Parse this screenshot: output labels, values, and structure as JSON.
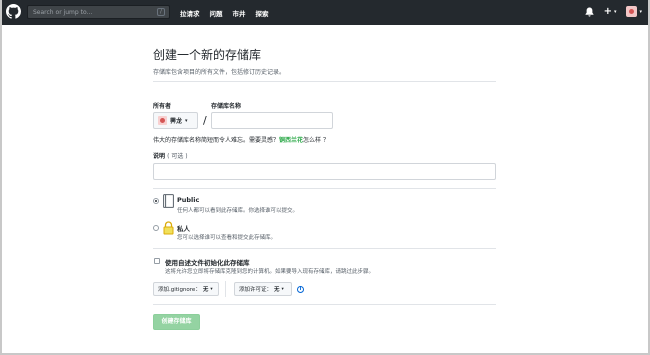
{
  "header": {
    "search_placeholder": "Search or jump to...",
    "search_shortcut": "/",
    "nav": [
      "拉请求",
      "问题",
      "市井",
      "探索"
    ],
    "plus_label": "+",
    "caret": "▾"
  },
  "page": {
    "title": "创建一个新的存储库",
    "subtitle": "存储库包含项目的所有文件，包括修订历史记录。"
  },
  "owner": {
    "label": "所有者",
    "value": "霁龙",
    "caret": "▾"
  },
  "repo_name": {
    "label": "存储库名称",
    "value": ""
  },
  "separator": "/",
  "hint": {
    "prefix": "伟大的存储库名称简短而令人难忘。需要灵感？",
    "suggestion": "铜西兰花",
    "suffix": "怎么样 ？"
  },
  "description": {
    "label": "说明",
    "optional": "( 可选 )",
    "value": ""
  },
  "visibility": {
    "public": {
      "title": "Public",
      "desc": "任何人都可以看到此存储库。你选择谁可以提交。",
      "selected": true
    },
    "private": {
      "title": "私人",
      "desc": "您可以选择谁可以查看和提交此存储库。",
      "selected": false
    }
  },
  "init": {
    "title": "使用自述文件初始化此存储库",
    "desc": "这将允许您立即将存储库克隆到您的计算机。如果要导入现有存储库，请跳过此步骤。",
    "checked": false
  },
  "gitignore": {
    "label": "添加.gitignore：",
    "value": "无",
    "caret": "▾"
  },
  "license": {
    "label": "添加许可证：",
    "value": "无",
    "caret": "▾"
  },
  "info_icon": "i",
  "create_button": "创建存储库",
  "colors": {
    "header_bg": "#24292e",
    "create_button": "#94d3a2",
    "suggestion": "#28a745"
  }
}
